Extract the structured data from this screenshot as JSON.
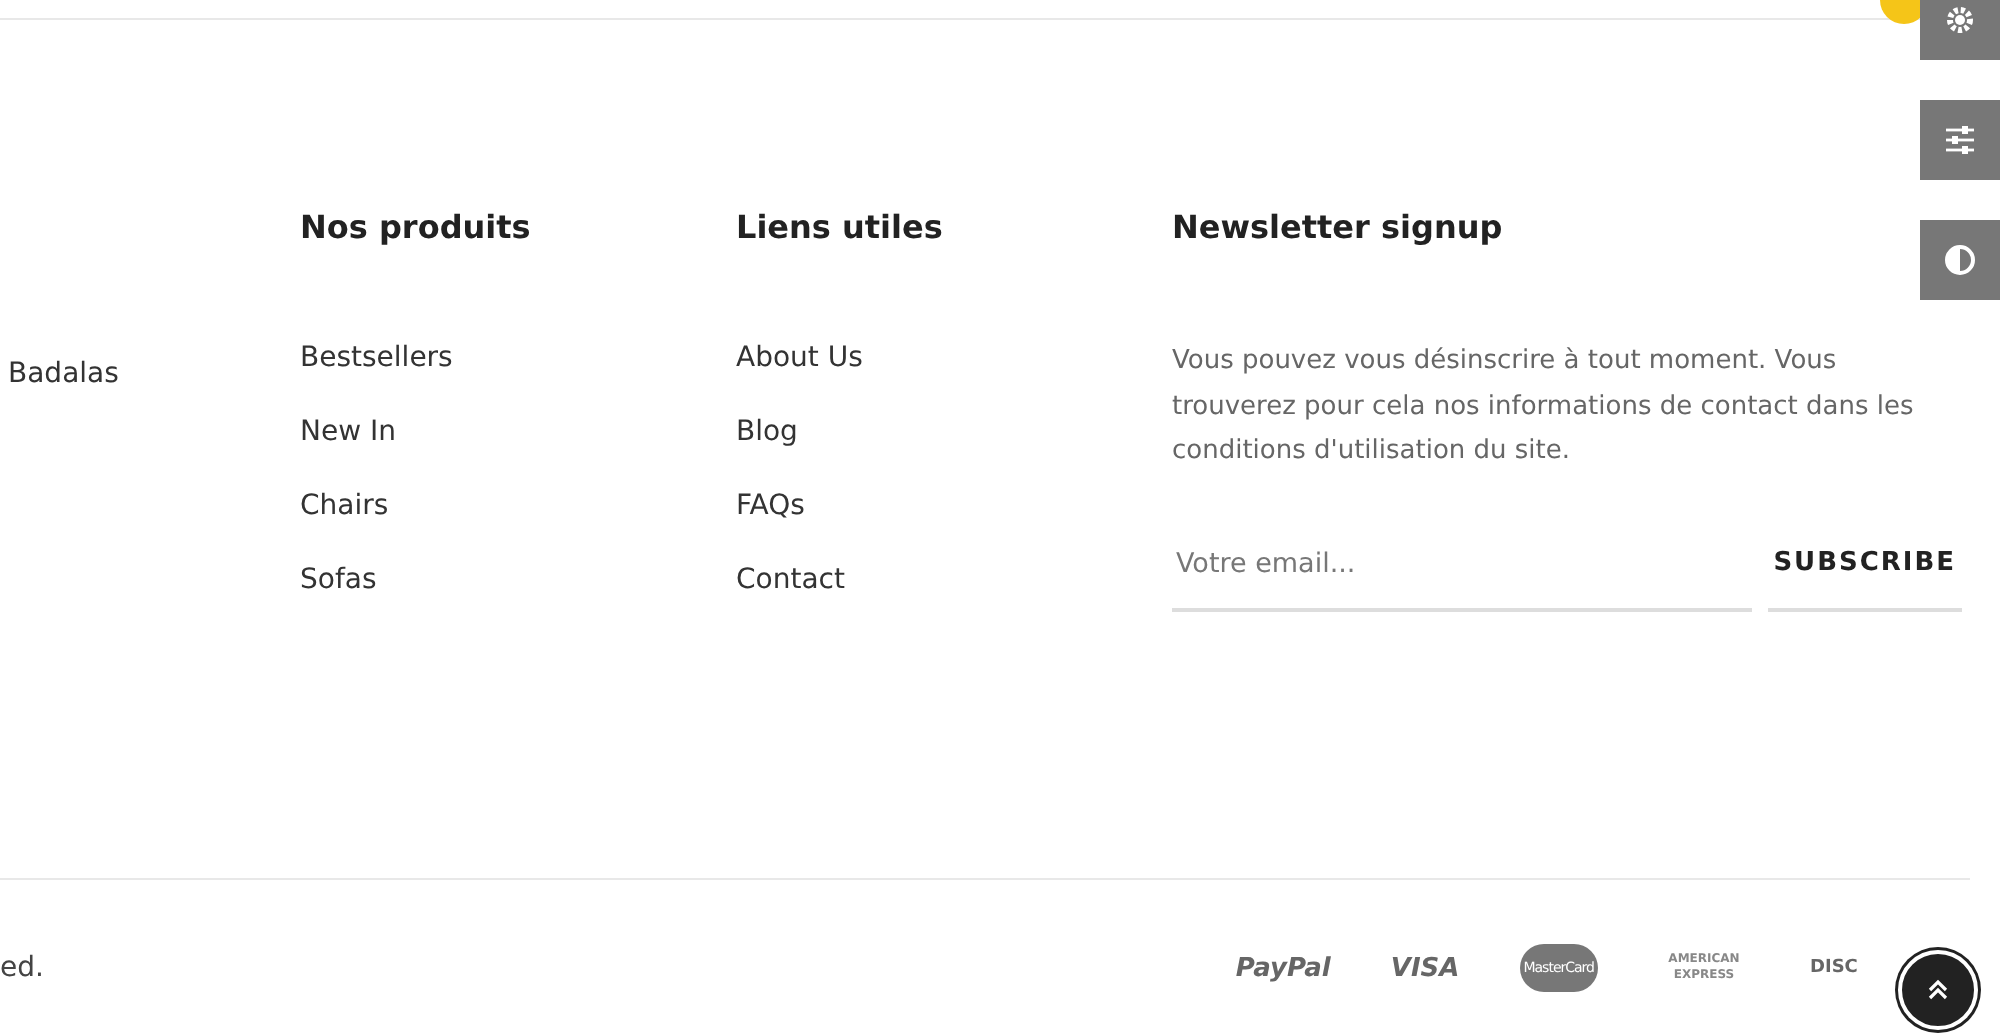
{
  "about": {
    "text": "Badalas"
  },
  "columns": [
    {
      "heading": "Nos produits",
      "links": [
        "Bestsellers",
        "New In",
        "Chairs",
        "Sofas"
      ]
    },
    {
      "heading": "Liens utiles",
      "links": [
        "About Us",
        "Blog",
        "FAQs",
        "Contact"
      ]
    }
  ],
  "newsletter": {
    "heading": "Newsletter signup",
    "text": "Vous pouvez vous désinscrire à tout moment. Vous trouverez pour cela nos informations de contact dans les conditions d'utilisation du site.",
    "placeholder": "Votre email...",
    "button": "SUBSCRIBE"
  },
  "copyright": "ed.",
  "payments": [
    {
      "kind": "paypal",
      "label": "PayPal"
    },
    {
      "kind": "visa",
      "label": "VISA"
    },
    {
      "kind": "mastercard",
      "label": "MasterCard"
    },
    {
      "kind": "amex",
      "label": "AMERICAN EXPRESS"
    },
    {
      "kind": "discover",
      "label": "DISC"
    }
  ]
}
